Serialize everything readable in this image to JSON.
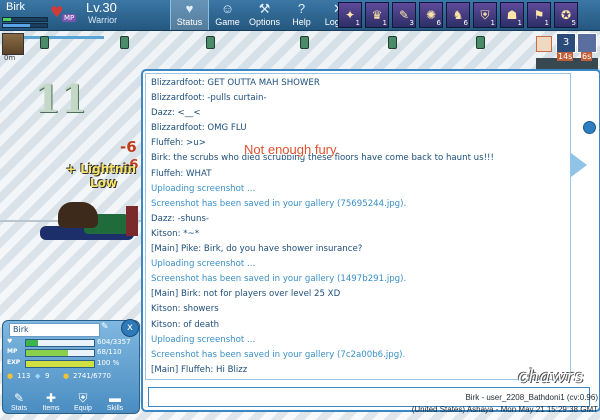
{
  "player": {
    "name": "Birk",
    "level": "Lv.30",
    "job": "Warrior",
    "mp_tag": "MP"
  },
  "top_bars": {
    "hp_fraction": 0.18,
    "mp_fraction": 0.62
  },
  "menu": [
    {
      "label": "Status",
      "icon": "heart-icon"
    },
    {
      "label": "Game",
      "icon": "person-icon"
    },
    {
      "label": "Options",
      "icon": "wrench-icon"
    },
    {
      "label": "Help",
      "icon": "question-icon"
    },
    {
      "label": "Logout",
      "icon": "x-icon"
    }
  ],
  "skills": [
    {
      "icon": "skill-1-icon",
      "glyph": "✦",
      "count": "1"
    },
    {
      "icon": "skill-2-icon",
      "glyph": "♛",
      "count": "1"
    },
    {
      "icon": "skill-3-icon",
      "glyph": "✎",
      "count": "3"
    },
    {
      "icon": "skill-4-icon",
      "glyph": "✺",
      "count": "6"
    },
    {
      "icon": "skill-5-icon",
      "glyph": "♞",
      "count": "6"
    },
    {
      "icon": "skill-6-icon",
      "glyph": "⛨",
      "count": "1"
    },
    {
      "icon": "skill-7-icon",
      "glyph": "☗",
      "count": "1"
    },
    {
      "icon": "skill-8-icon",
      "glyph": "⚑",
      "count": "1"
    },
    {
      "icon": "skill-9-icon",
      "glyph": "✪",
      "count": "5"
    }
  ],
  "target": {
    "label": "0m"
  },
  "effects": {
    "big_number": "11",
    "damage_a": "-6",
    "damage_b": "-6",
    "lightning": "+ Lightnin",
    "low": "Low",
    "fury": "Not enough fury."
  },
  "timers": [
    {
      "value": "3",
      "seconds": "14s"
    },
    {
      "value": "",
      "seconds": "6s"
    }
  ],
  "chat": [
    {
      "type": "normal",
      "text": "Blizzardfoot: GET OUTTA MAH SHOWER"
    },
    {
      "type": "normal",
      "text": "Blizzardfoot: -pulls curtain-"
    },
    {
      "type": "normal",
      "text": "Dazz: <__<"
    },
    {
      "type": "normal",
      "text": "Blizzardfoot: OMG FLU"
    },
    {
      "type": "normal",
      "text": "Fluffeh: >u>"
    },
    {
      "type": "normal",
      "text": "Birk: the scrubs who died scrubbing these floors have come back to haunt us!!!"
    },
    {
      "type": "normal",
      "text": "Fluffeh: WHAT"
    },
    {
      "type": "sys",
      "text": "Uploading screenshot ..."
    },
    {
      "type": "sys",
      "text": "Screenshot has been saved in your gallery (75695244.jpg)."
    },
    {
      "type": "normal",
      "text": "Dazz: -shuns-"
    },
    {
      "type": "normal",
      "text": "Kitson: *~*"
    },
    {
      "type": "normal",
      "text": "[Main] Pike: Birk, do you have shower insurance?"
    },
    {
      "type": "sys",
      "text": "Uploading screenshot ..."
    },
    {
      "type": "sys",
      "text": "Screenshot has been saved in your gallery (1497b291.jpg)."
    },
    {
      "type": "normal",
      "text": "[Main] Birk: not for players over level 25 XD"
    },
    {
      "type": "normal",
      "text": "Kitson: showers"
    },
    {
      "type": "normal",
      "text": "Kitson: of death"
    },
    {
      "type": "sys",
      "text": "Uploading screenshot ..."
    },
    {
      "type": "sys",
      "text": "Screenshot has been saved in your gallery (7c2a00b6.jpg)."
    },
    {
      "type": "normal",
      "text": "[Main] Fluffeh: Hi Blizz"
    }
  ],
  "stats": {
    "name": "Birk",
    "close": "x",
    "rows": [
      {
        "label": "♥",
        "value": "604/3357",
        "fraction": 0.18,
        "color": "#3bb54a"
      },
      {
        "label": "MP",
        "value": "68/110",
        "fraction": 0.62,
        "color": "#8ad14b"
      },
      {
        "label": "EXP",
        "value": "100 %",
        "fraction": 1.0,
        "color": "#d0e040"
      }
    ],
    "resources": {
      "gold": "113",
      "gems": "9",
      "xp": "2741/6770"
    },
    "buttons": [
      "Stats",
      "Items",
      "Equip",
      "Skills"
    ]
  },
  "status": {
    "line1": "Birk - user_2208_Bathdoni1 (cv:0.96)",
    "line2": "(United States) Ashaya - Mon May 21 15:29:38 GMT"
  },
  "watermark": "chawrs"
}
